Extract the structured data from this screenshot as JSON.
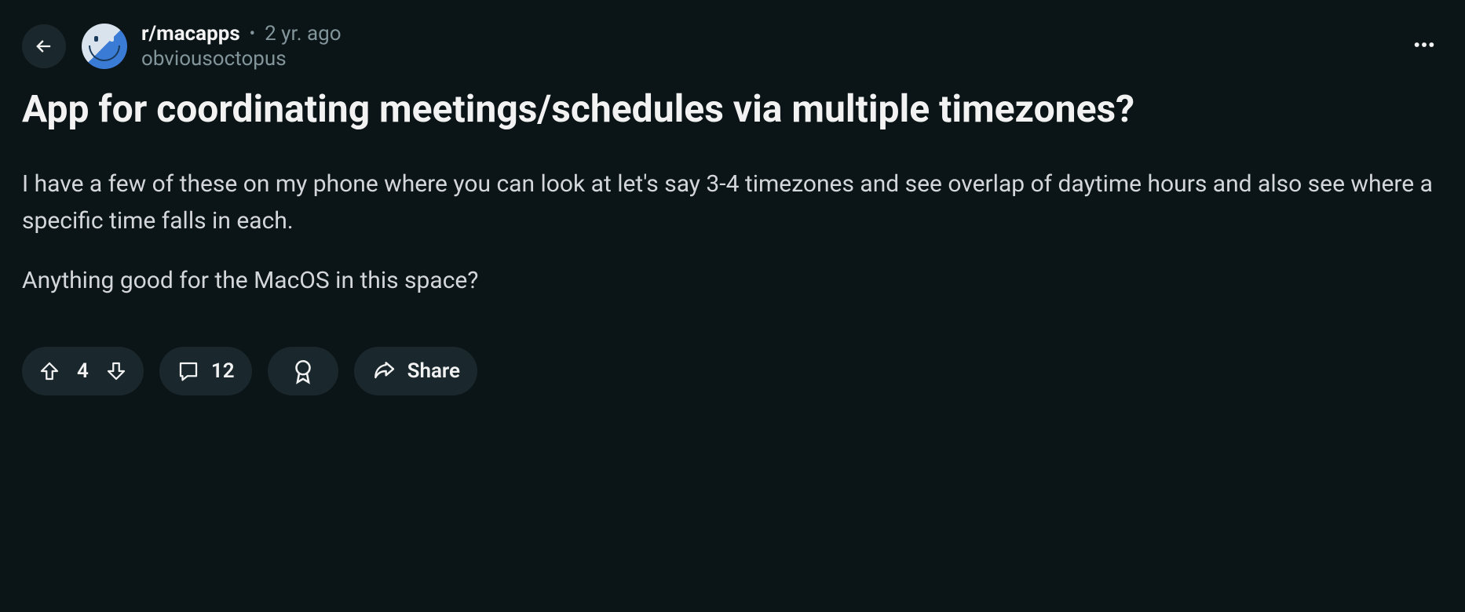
{
  "post": {
    "subreddit": "r/macapps",
    "timestamp": "2 yr. ago",
    "author": "obviousoctopus",
    "title": "App for coordinating meetings/schedules via multiple timezones?",
    "body_paragraph_1": "I have a few of these on my phone where you can look at let's say 3-4 timezones and see overlap of daytime hours and also see where a specific time falls in each.",
    "body_paragraph_2": "Anything good for the MacOS in this space?"
  },
  "actions": {
    "vote_count": "4",
    "comment_count": "12",
    "share_label": "Share"
  }
}
